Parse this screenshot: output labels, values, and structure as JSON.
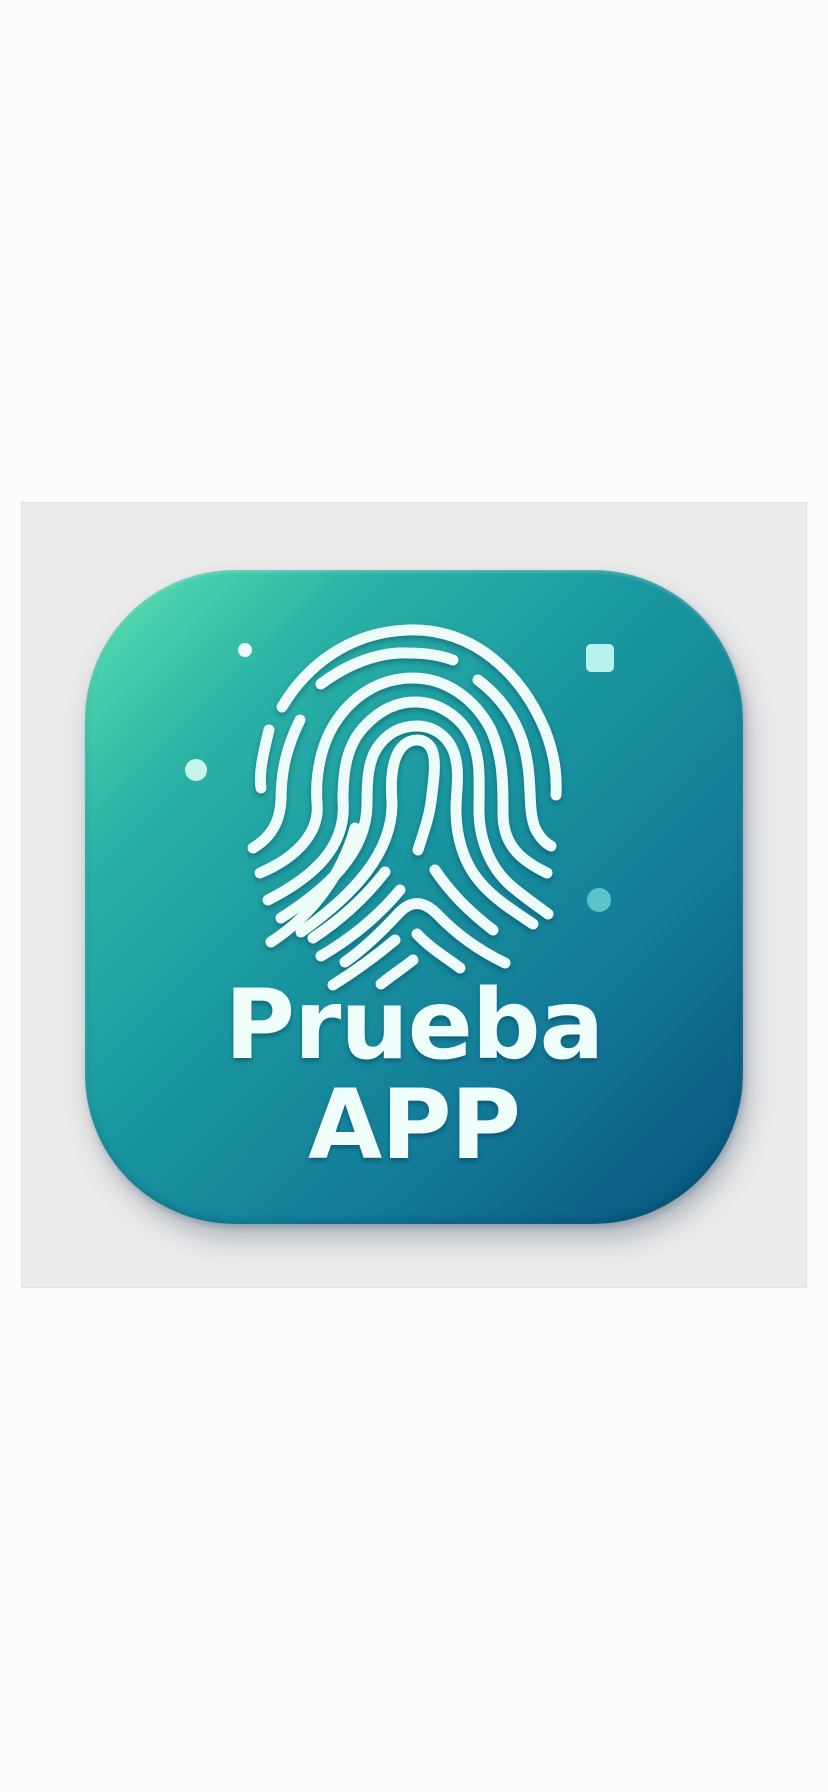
{
  "app_icon": {
    "name_line_1": "Prueba",
    "name_line_2": "APP",
    "symbol": "fingerprint-icon",
    "colors": {
      "gradient_start": "#5ee3b0",
      "gradient_end": "#08517a",
      "foreground": "#effdfb"
    }
  }
}
